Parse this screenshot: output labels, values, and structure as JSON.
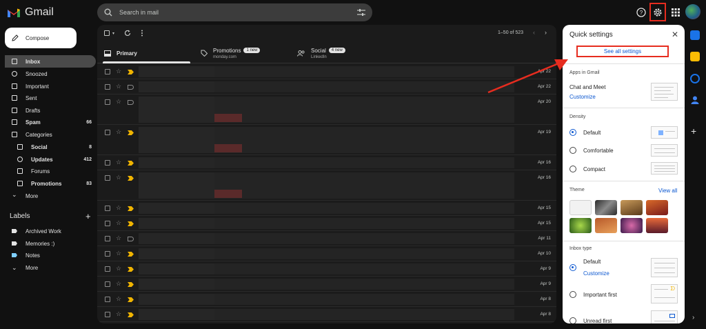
{
  "app": {
    "name": "Gmail"
  },
  "search": {
    "placeholder": "Search in mail"
  },
  "sidebar": {
    "compose": "Compose",
    "items": [
      {
        "label": "Inbox",
        "count": ""
      },
      {
        "label": "Snoozed",
        "count": ""
      },
      {
        "label": "Important",
        "count": ""
      },
      {
        "label": "Sent",
        "count": ""
      },
      {
        "label": "Drafts",
        "count": ""
      },
      {
        "label": "Spam",
        "count": "66"
      },
      {
        "label": "Categories",
        "count": ""
      },
      {
        "label": "Social",
        "count": "8"
      },
      {
        "label": "Updates",
        "count": "412"
      },
      {
        "label": "Forums",
        "count": ""
      },
      {
        "label": "Promotions",
        "count": "83"
      },
      {
        "label": "More",
        "count": ""
      }
    ],
    "labels_title": "Labels",
    "labels": [
      "Archived Work",
      "Memories :)",
      "Notes",
      "More"
    ],
    "label_colors": [
      "#e3e3e3",
      "#e3e3e3",
      "#7fcfff",
      "#e3e3e3"
    ]
  },
  "mail": {
    "pager": "1–50 of 523",
    "tabs": [
      {
        "label": "Primary",
        "sub": "",
        "badge": ""
      },
      {
        "label": "Promotions",
        "sub": "monday.com",
        "badge": "1 new"
      },
      {
        "label": "Social",
        "sub": "LinkedIn",
        "badge": "4 new"
      }
    ],
    "rows": [
      {
        "date": "Apr 22",
        "important": true
      },
      {
        "date": "Apr 22",
        "important": false
      },
      {
        "date": "Apr 20",
        "important": false
      },
      {
        "date": "Apr 19",
        "important": true
      },
      {
        "date": "Apr 16",
        "important": true
      },
      {
        "date": "Apr 16",
        "important": true
      },
      {
        "date": "Apr 15",
        "important": true
      },
      {
        "date": "Apr 15",
        "important": true
      },
      {
        "date": "Apr 11",
        "important": false
      },
      {
        "date": "Apr 10",
        "important": true
      },
      {
        "date": "Apr 9",
        "important": true
      },
      {
        "date": "Apr 9",
        "important": true
      },
      {
        "date": "Apr 8",
        "important": true
      },
      {
        "date": "Apr 8",
        "important": true
      }
    ]
  },
  "quick_settings": {
    "title": "Quick settings",
    "see_all": "See all settings",
    "apps_header": "Apps in Gmail",
    "chat_meet": "Chat and Meet",
    "customize": "Customize",
    "density_header": "Density",
    "density": [
      "Default",
      "Comfortable",
      "Compact"
    ],
    "theme_header": "Theme",
    "view_all": "View all",
    "inbox_type_header": "Inbox type",
    "inbox_types": [
      "Default",
      "Important first",
      "Unread first"
    ],
    "inbox_customize": "Customize"
  },
  "colors": {
    "accent": "#0b57d0",
    "highlight": "#e62c1f",
    "important": "#f0b400"
  }
}
